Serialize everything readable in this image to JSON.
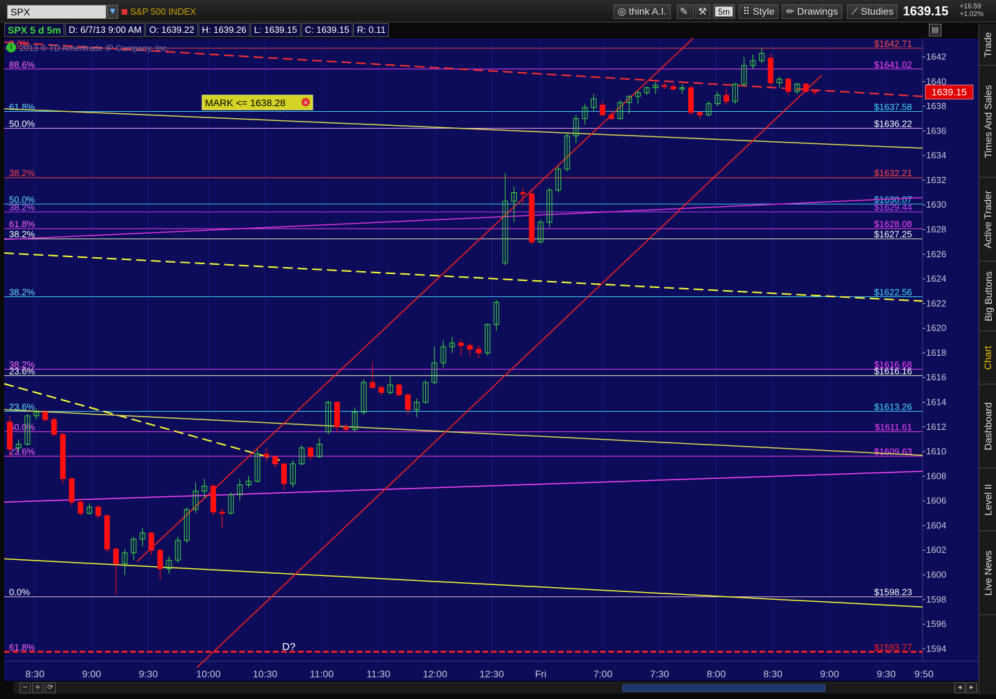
{
  "toolbar": {
    "symbol": "SPX",
    "index_name": "S&P 500 INDEX",
    "think_ai": "think A.I.",
    "timeframe": "5m",
    "style": "Style",
    "drawings": "Drawings",
    "studies": "Studies",
    "last_price": "1639.15",
    "net_change": "+16.59",
    "pct_change": "+1.02%"
  },
  "info": {
    "study": "SPX 5 d 5m",
    "date": "D: 6/7/13 9:00 AM",
    "open": "O: 1639.22",
    "high": "H: 1639.26",
    "low": "L: 1639.15",
    "close": "C: 1639.15",
    "range": "R: 0.11"
  },
  "copyright": "2013 © TD Ameritrade IP Company, Inc.",
  "side_tabs": [
    "Trade",
    "Times And Sales",
    "Active Trader",
    "Big Buttons",
    "Chart",
    "Dashboard",
    "Level II",
    "Live News"
  ],
  "colors": {
    "background": "#0c0c5a",
    "up": "#3fd93f",
    "down": "#ff1010",
    "price_label": "#e00000"
  },
  "chart_data": {
    "type": "candlestick",
    "y_axis": {
      "min": 1593,
      "max": 1643.5,
      "ticks": [
        1594,
        1596,
        1598,
        1600,
        1602,
        1604,
        1606,
        1608,
        1610,
        1612,
        1614,
        1616,
        1618,
        1620,
        1622,
        1624,
        1626,
        1628,
        1630,
        1632,
        1634,
        1636,
        1638,
        1640,
        1642
      ]
    },
    "x_axis": {
      "labels": [
        "8:30",
        "9:00",
        "9:30",
        "10:00",
        "10:30",
        "11:00",
        "11:30",
        "12:00",
        "12:30",
        "Fri",
        "7:00",
        "7:30",
        "8:00",
        "8:30",
        "9:00",
        "9:30",
        "9:50"
      ]
    },
    "mark": "MARK <= 1638.28",
    "pattern_label": "D?",
    "current_price": "1639.15",
    "fib_levels": [
      {
        "pct": "0.0%",
        "price": "1642.71",
        "value": 1642.71,
        "color": "#ff4444",
        "pct_color": "#ff4444"
      },
      {
        "pct": "88.6%",
        "price": "1641.02",
        "value": 1641.02,
        "color": "#ff44ff",
        "pct_color": "#ff66ff"
      },
      {
        "pct": "61.8%",
        "price": "1637.58",
        "value": 1637.58,
        "color": "#44ddff",
        "pct_color": "#66ddff"
      },
      {
        "pct": "50.0%",
        "price": "1636.22",
        "value": 1636.22,
        "color": "#ffaaff",
        "pct_color": "#ffffff"
      },
      {
        "pct": "38.2%",
        "price": "1632.21",
        "value": 1632.21,
        "color": "#ff4444",
        "pct_color": "#ff4444"
      },
      {
        "pct": "50.0%",
        "price": "1630.07",
        "value": 1630.07,
        "color": "#44ddff",
        "pct_color": "#66ddff"
      },
      {
        "pct": "38.2%",
        "price": "1629.44",
        "value": 1629.44,
        "color": "#cc44ff",
        "pct_color": "#cc66ff"
      },
      {
        "pct": "61.8%",
        "price": "1628.08",
        "value": 1628.08,
        "color": "#ff44ff",
        "pct_color": "#ff66ff"
      },
      {
        "pct": "38.2%",
        "price": "1627.25",
        "value": 1627.25,
        "color": "#ffffcc",
        "pct_color": "#ffffff"
      },
      {
        "pct": "38.2%",
        "price": "1622.56",
        "value": 1622.56,
        "color": "#44ddff",
        "pct_color": "#66ddff"
      },
      {
        "pct": "38.2%",
        "price": "1616.68",
        "value": 1616.68,
        "color": "#ff44ff",
        "pct_color": "#ff66ff"
      },
      {
        "pct": "23.6%",
        "price": "1616.16",
        "value": 1616.16,
        "color": "#ffffcc",
        "pct_color": "#ffffff"
      },
      {
        "pct": "23.6%",
        "price": "1613.26",
        "value": 1613.26,
        "color": "#44ddff",
        "pct_color": "#66ddff"
      },
      {
        "pct": "50.0%",
        "price": "1611.61",
        "value": 1611.61,
        "color": "#ff44ff",
        "pct_color": "#ff66ff"
      },
      {
        "pct": "23.6%",
        "price": "1609.63",
        "value": 1609.63,
        "color": "#ff44ff",
        "pct_color": "#ff66ff"
      },
      {
        "pct": "0.0%",
        "price": "1598.23",
        "value": 1598.23,
        "color": "#ffccdd",
        "pct_color": "#ffffff"
      },
      {
        "pct": "61.8%",
        "price": "1593.77",
        "value": 1593.77,
        "color": "#ff2020",
        "pct_color": "#ff66ff"
      }
    ],
    "trend_lines": [
      {
        "color": "#ff3030",
        "dash": true,
        "from": [
          0,
          1643.2
        ],
        "to": [
          1,
          1638.8
        ]
      },
      {
        "color": "#ffff33",
        "dash": true,
        "from": [
          0,
          1626.1
        ],
        "to": [
          1,
          1622.2
        ]
      },
      {
        "color": "#ffff33",
        "dash": true,
        "from": [
          0,
          1615.5
        ],
        "to": [
          0.3,
          1609.3
        ]
      },
      {
        "color": "#dddd55",
        "dash": false,
        "from": [
          0,
          1637.8
        ],
        "to": [
          1,
          1634.6
        ]
      },
      {
        "color": "#dddd55",
        "dash": false,
        "from": [
          0,
          1613.4
        ],
        "to": [
          1,
          1609.7
        ]
      },
      {
        "color": "#ffff33",
        "dash": false,
        "from": [
          0,
          1601.3
        ],
        "to": [
          1,
          1597.4
        ]
      },
      {
        "color": "#dd33dd",
        "dash": false,
        "from": [
          0,
          1627.2
        ],
        "to": [
          1,
          1630.6
        ]
      },
      {
        "color": "#ff44ff",
        "dash": false,
        "from": [
          0,
          1605.9
        ],
        "to": [
          1,
          1608.4
        ]
      },
      {
        "color": "#ff2020",
        "dash": false,
        "from": [
          0.145,
          1601.1
        ],
        "to": [
          0.75,
          1643.5
        ]
      },
      {
        "color": "#ff2020",
        "dash": false,
        "from": [
          0.21,
          1592.5
        ],
        "to": [
          0.89,
          1640.5
        ]
      }
    ],
    "candles": [
      {
        "o": 1612.4,
        "h": 1612.9,
        "l": 1609.5,
        "c": 1610.2
      },
      {
        "o": 1610.3,
        "h": 1611.0,
        "l": 1610.0,
        "c": 1610.6
      },
      {
        "o": 1610.6,
        "h": 1613.0,
        "l": 1610.5,
        "c": 1612.9
      },
      {
        "o": 1612.9,
        "h": 1613.5,
        "l": 1612.6,
        "c": 1613.2
      },
      {
        "o": 1613.2,
        "h": 1613.4,
        "l": 1612.4,
        "c": 1612.6
      },
      {
        "o": 1612.6,
        "h": 1612.8,
        "l": 1611.2,
        "c": 1611.4
      },
      {
        "o": 1611.4,
        "h": 1611.5,
        "l": 1607.4,
        "c": 1607.8
      },
      {
        "o": 1607.8,
        "h": 1607.9,
        "l": 1605.6,
        "c": 1605.9
      },
      {
        "o": 1605.9,
        "h": 1606.2,
        "l": 1604.8,
        "c": 1605.0
      },
      {
        "o": 1605.0,
        "h": 1605.8,
        "l": 1604.9,
        "c": 1605.5
      },
      {
        "o": 1605.5,
        "h": 1605.7,
        "l": 1604.6,
        "c": 1604.8
      },
      {
        "o": 1604.8,
        "h": 1604.9,
        "l": 1601.8,
        "c": 1602.1
      },
      {
        "o": 1602.1,
        "h": 1602.2,
        "l": 1598.4,
        "c": 1600.9
      },
      {
        "o": 1600.9,
        "h": 1602.1,
        "l": 1600.0,
        "c": 1601.8
      },
      {
        "o": 1601.8,
        "h": 1603.1,
        "l": 1601.2,
        "c": 1602.9
      },
      {
        "o": 1602.9,
        "h": 1603.8,
        "l": 1602.3,
        "c": 1603.4
      },
      {
        "o": 1603.4,
        "h": 1603.5,
        "l": 1601.6,
        "c": 1602.0
      },
      {
        "o": 1602.0,
        "h": 1602.1,
        "l": 1599.6,
        "c": 1600.5
      },
      {
        "o": 1600.5,
        "h": 1601.5,
        "l": 1600.1,
        "c": 1601.2
      },
      {
        "o": 1601.2,
        "h": 1603.1,
        "l": 1601.0,
        "c": 1602.8
      },
      {
        "o": 1602.8,
        "h": 1605.5,
        "l": 1602.6,
        "c": 1605.3
      },
      {
        "o": 1605.3,
        "h": 1607.5,
        "l": 1605.0,
        "c": 1606.8
      },
      {
        "o": 1606.8,
        "h": 1607.8,
        "l": 1606.2,
        "c": 1607.2
      },
      {
        "o": 1607.2,
        "h": 1607.4,
        "l": 1604.8,
        "c": 1605.1
      },
      {
        "o": 1605.1,
        "h": 1605.4,
        "l": 1603.8,
        "c": 1605.0
      },
      {
        "o": 1605.0,
        "h": 1606.7,
        "l": 1604.9,
        "c": 1606.5
      },
      {
        "o": 1606.5,
        "h": 1607.8,
        "l": 1606.0,
        "c": 1607.3
      },
      {
        "o": 1607.3,
        "h": 1608.0,
        "l": 1607.1,
        "c": 1607.6
      },
      {
        "o": 1607.6,
        "h": 1610.2,
        "l": 1607.5,
        "c": 1609.8
      },
      {
        "o": 1609.8,
        "h": 1610.3,
        "l": 1609.2,
        "c": 1609.6
      },
      {
        "o": 1609.6,
        "h": 1609.7,
        "l": 1608.7,
        "c": 1609.0
      },
      {
        "o": 1609.0,
        "h": 1609.1,
        "l": 1606.9,
        "c": 1607.4
      },
      {
        "o": 1607.4,
        "h": 1609.3,
        "l": 1607.1,
        "c": 1609.0
      },
      {
        "o": 1609.0,
        "h": 1610.5,
        "l": 1608.9,
        "c": 1610.3
      },
      {
        "o": 1610.3,
        "h": 1610.4,
        "l": 1609.3,
        "c": 1609.6
      },
      {
        "o": 1609.6,
        "h": 1611.1,
        "l": 1609.5,
        "c": 1610.6
      },
      {
        "o": 1611.6,
        "h": 1614.1,
        "l": 1611.4,
        "c": 1614.0
      },
      {
        "o": 1614.0,
        "h": 1614.1,
        "l": 1611.6,
        "c": 1612.0
      },
      {
        "o": 1612.0,
        "h": 1612.3,
        "l": 1611.6,
        "c": 1611.8
      },
      {
        "o": 1611.8,
        "h": 1613.6,
        "l": 1611.6,
        "c": 1613.2
      },
      {
        "o": 1613.2,
        "h": 1615.9,
        "l": 1613.0,
        "c": 1615.6
      },
      {
        "o": 1615.6,
        "h": 1617.3,
        "l": 1615.1,
        "c": 1615.2
      },
      {
        "o": 1615.2,
        "h": 1615.4,
        "l": 1614.5,
        "c": 1614.8
      },
      {
        "o": 1614.8,
        "h": 1616.2,
        "l": 1614.6,
        "c": 1615.4
      },
      {
        "o": 1615.4,
        "h": 1615.5,
        "l": 1614.5,
        "c": 1614.6
      },
      {
        "o": 1614.6,
        "h": 1614.7,
        "l": 1613.0,
        "c": 1613.4
      },
      {
        "o": 1613.4,
        "h": 1614.3,
        "l": 1612.8,
        "c": 1614.0
      },
      {
        "o": 1614.0,
        "h": 1615.8,
        "l": 1613.9,
        "c": 1615.6
      },
      {
        "o": 1615.6,
        "h": 1618.5,
        "l": 1615.5,
        "c": 1617.2
      },
      {
        "o": 1617.2,
        "h": 1619.0,
        "l": 1616.8,
        "c": 1618.5
      },
      {
        "o": 1618.5,
        "h": 1619.3,
        "l": 1618.0,
        "c": 1618.8
      },
      {
        "o": 1618.8,
        "h": 1619.1,
        "l": 1617.8,
        "c": 1618.6
      },
      {
        "o": 1618.6,
        "h": 1618.8,
        "l": 1617.7,
        "c": 1618.3
      },
      {
        "o": 1618.3,
        "h": 1618.6,
        "l": 1617.6,
        "c": 1618.0
      },
      {
        "o": 1618.0,
        "h": 1620.4,
        "l": 1617.8,
        "c": 1620.3
      },
      {
        "o": 1620.3,
        "h": 1622.3,
        "l": 1619.8,
        "c": 1622.1
      },
      {
        "o": 1625.3,
        "h": 1632.6,
        "l": 1625.1,
        "c": 1630.3
      },
      {
        "o": 1630.3,
        "h": 1631.5,
        "l": 1628.6,
        "c": 1631.0
      },
      {
        "o": 1631.0,
        "h": 1631.4,
        "l": 1630.0,
        "c": 1630.9
      },
      {
        "o": 1630.9,
        "h": 1631.3,
        "l": 1626.8,
        "c": 1627.0
      },
      {
        "o": 1627.0,
        "h": 1628.8,
        "l": 1626.9,
        "c": 1628.6
      },
      {
        "o": 1628.6,
        "h": 1631.4,
        "l": 1628.2,
        "c": 1631.2
      },
      {
        "o": 1631.2,
        "h": 1633.2,
        "l": 1631.0,
        "c": 1632.9
      },
      {
        "o": 1632.9,
        "h": 1635.8,
        "l": 1632.7,
        "c": 1635.6
      },
      {
        "o": 1635.6,
        "h": 1637.3,
        "l": 1635.0,
        "c": 1637.0
      },
      {
        "o": 1637.0,
        "h": 1638.2,
        "l": 1636.5,
        "c": 1637.9
      },
      {
        "o": 1637.9,
        "h": 1639.0,
        "l": 1637.6,
        "c": 1638.6
      },
      {
        "o": 1638.1,
        "h": 1638.4,
        "l": 1637.2,
        "c": 1637.3
      },
      {
        "o": 1637.3,
        "h": 1637.7,
        "l": 1636.9,
        "c": 1637.0
      },
      {
        "o": 1637.0,
        "h": 1638.5,
        "l": 1636.9,
        "c": 1638.3
      },
      {
        "o": 1638.3,
        "h": 1638.9,
        "l": 1637.4,
        "c": 1638.8
      },
      {
        "o": 1638.8,
        "h": 1639.3,
        "l": 1638.2,
        "c": 1639.1
      },
      {
        "o": 1639.1,
        "h": 1639.6,
        "l": 1638.9,
        "c": 1639.5
      },
      {
        "o": 1639.5,
        "h": 1640.0,
        "l": 1639.0,
        "c": 1639.7
      },
      {
        "o": 1639.7,
        "h": 1639.9,
        "l": 1639.4,
        "c": 1639.6
      },
      {
        "o": 1639.6,
        "h": 1639.8,
        "l": 1639.3,
        "c": 1639.4
      },
      {
        "o": 1639.4,
        "h": 1639.8,
        "l": 1639.0,
        "c": 1639.5
      },
      {
        "o": 1639.5,
        "h": 1639.7,
        "l": 1637.3,
        "c": 1637.5
      },
      {
        "o": 1637.5,
        "h": 1637.6,
        "l": 1637.0,
        "c": 1637.3
      },
      {
        "o": 1637.3,
        "h": 1638.4,
        "l": 1637.2,
        "c": 1638.2
      },
      {
        "o": 1638.2,
        "h": 1639.2,
        "l": 1638.0,
        "c": 1638.9
      },
      {
        "o": 1638.9,
        "h": 1639.4,
        "l": 1638.1,
        "c": 1638.4
      },
      {
        "o": 1638.4,
        "h": 1639.9,
        "l": 1638.2,
        "c": 1639.8
      },
      {
        "o": 1639.8,
        "h": 1642.0,
        "l": 1639.6,
        "c": 1641.3
      },
      {
        "o": 1641.3,
        "h": 1642.2,
        "l": 1641.0,
        "c": 1641.7
      },
      {
        "o": 1641.7,
        "h": 1642.7,
        "l": 1641.5,
        "c": 1642.3
      },
      {
        "o": 1641.9,
        "h": 1642.3,
        "l": 1639.6,
        "c": 1639.9
      },
      {
        "o": 1639.9,
        "h": 1640.4,
        "l": 1639.5,
        "c": 1640.2
      },
      {
        "o": 1640.2,
        "h": 1640.3,
        "l": 1638.9,
        "c": 1639.2
      },
      {
        "o": 1639.2,
        "h": 1639.9,
        "l": 1639.0,
        "c": 1639.8
      },
      {
        "o": 1639.8,
        "h": 1639.9,
        "l": 1639.1,
        "c": 1639.2
      },
      {
        "o": 1639.2,
        "h": 1639.3,
        "l": 1638.9,
        "c": 1639.15
      }
    ]
  }
}
